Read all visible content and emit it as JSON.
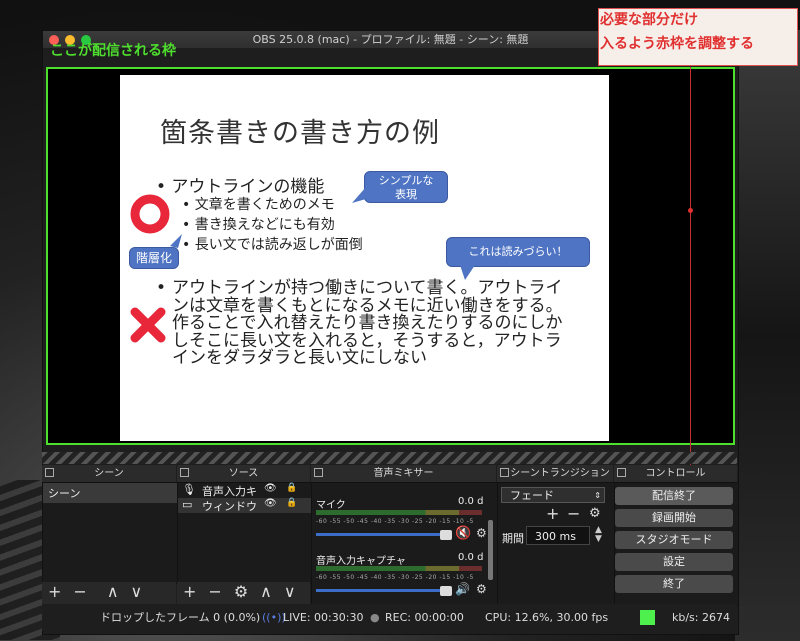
{
  "window": {
    "title": "OBS 25.0.8 (mac) - プロファイル: 無題 - シーン: 無題"
  },
  "annotations": {
    "frame_label": "ここが配信される枠",
    "red_note_line1": "必要な部分だけ",
    "red_note_line2": "入るよう赤枠を調整する"
  },
  "slide": {
    "title": "箇条書きの書き方の例",
    "bullet_main": "• アウトラインの機能",
    "sub_items": [
      "• 文章を書くためのメモ",
      "• 書き換えなどにも有効",
      "• 長い文では読み返しが面倒"
    ],
    "para_bullet": "•",
    "paragraph": "アウトラインが持つ働きについて書く。アウトラインは文章を書くもとになるメモに近い働きをする。作ることで入れ替えたり書き換えたりするのにしかしそこに長い文を入れると，そうすると，アウトラインをダラダラと長い文にしない",
    "bubble_simple_1": "シンプルな",
    "bubble_simple_2": "表現",
    "bubble_hard": "これは読みづらい！",
    "bubble_hier": "階層化"
  },
  "docks": {
    "scenes": {
      "title": "シーン",
      "items": [
        "シーン"
      ]
    },
    "sources": {
      "title": "ソース",
      "items": [
        "音声入力キ",
        "ウィンドウ"
      ]
    },
    "mixer": {
      "title": "音声ミキサー",
      "channels": [
        {
          "name": "マイク",
          "db": "0.0 d"
        },
        {
          "name": "音声入力キャプチャ",
          "db": "0.0 d"
        }
      ],
      "ticks": "-60 -55 -50 -45 -40 -35 -30 -25 -20 -15 -10 -5"
    },
    "transitions": {
      "title": "シーントランジション",
      "selected": "フェード",
      "duration_label": "期間",
      "duration_value": "300 ms"
    },
    "controls": {
      "title": "コントロール",
      "buttons": [
        "配信終了",
        "録画開始",
        "スタジオモード",
        "設定",
        "終了"
      ]
    }
  },
  "status": {
    "dropped": "ドロップしたフレーム 0 (0.0%)",
    "live": "LIVE: 00:30:30",
    "rec": "REC: 00:00:00",
    "cpu": "CPU: 12.6%, 30.00 fps",
    "kbps": "kb/s: 2674"
  },
  "colors": {
    "frame_green": "#4ede2e",
    "annotation_red": "#e03030",
    "bubble_blue": "#4f74c4",
    "status_green": "#4ef04e"
  },
  "icons": {
    "add": "+",
    "remove": "−",
    "up": "∧",
    "down": "∨",
    "gear": "⚙",
    "eye": "👁",
    "lock": "🔒",
    "speaker": "🔊"
  }
}
